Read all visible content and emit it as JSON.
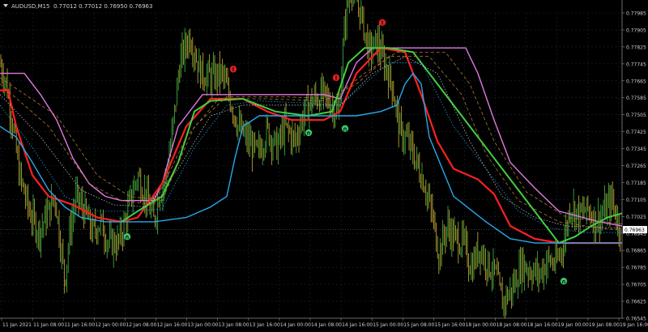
{
  "header": {
    "symbol": "AUDUSD,M15",
    "ohlc": "0.77012 0.77012 0.76950 0.76963"
  },
  "colors": {
    "background": "#000000",
    "grid": "#1c2436",
    "axis": "#8a8a8a",
    "text": "#d0d0d0",
    "candle_up": "#3fa63f",
    "candle_down": "#b7a12e",
    "band_outer": "#e07ae0",
    "band_blue": "#2aa8e8",
    "band_red": "#ff2020",
    "band_green": "#40d040",
    "band_dotted": "#d0d0d0",
    "band_dashed": "#b07a30",
    "signal_up": "#3cc86a",
    "signal_down": "#e02020",
    "price_tag_bg": "#ffffff",
    "price_tag_text": "#000000"
  },
  "chart_data": {
    "type": "candlestick",
    "ylim": [
      0.76545,
      0.77905
    ],
    "price_axis_labels": [
      "0.77985",
      "0.77905",
      "0.77825",
      "0.77745",
      "0.77665",
      "0.77585",
      "0.77505",
      "0.77425",
      "0.77345",
      "0.77265",
      "0.77185",
      "0.77105",
      "0.77025",
      "0.76945",
      "0.76865",
      "0.76785",
      "0.76705",
      "0.76625",
      "0.76545"
    ],
    "current_price": "0.76963",
    "time_axis_labels": [
      "11 Jan 2021",
      "11 Jan 08:00",
      "11 Jan 16:00",
      "12 Jan 00:00",
      "12 Jan 08:00",
      "12 Jan 16:00",
      "13 Jan 00:00",
      "13 Jan 08:00",
      "13 Jan 16:00",
      "14 Jan 00:00",
      "14 Jan 08:00",
      "14 Jan 16:00",
      "15 Jan 00:00",
      "15 Jan 08:00",
      "15 Jan 16:00",
      "18 Jan 00:00",
      "18 Jan 08:00",
      "18 Jan 16:00",
      "19 Jan 00:00",
      "19 Jan 08:00",
      "19 Jan 16:00"
    ],
    "price_path": [
      [
        0,
        0.7775
      ],
      [
        8,
        0.7765
      ],
      [
        16,
        0.7745
      ],
      [
        24,
        0.7722
      ],
      [
        36,
        0.7705
      ],
      [
        48,
        0.7695
      ],
      [
        60,
        0.7705
      ],
      [
        68,
        0.7712
      ],
      [
        74,
        0.7692
      ],
      [
        80,
        0.7672
      ],
      [
        86,
        0.7695
      ],
      [
        94,
        0.7712
      ],
      [
        104,
        0.7705
      ],
      [
        114,
        0.7695
      ],
      [
        124,
        0.77
      ],
      [
        134,
        0.769
      ],
      [
        146,
        0.769
      ],
      [
        156,
        0.7702
      ],
      [
        162,
        0.7712
      ],
      [
        170,
        0.7722
      ],
      [
        180,
        0.7712
      ],
      [
        190,
        0.77
      ],
      [
        196,
        0.7712
      ],
      [
        204,
        0.772
      ],
      [
        212,
        0.774
      ],
      [
        222,
        0.7775
      ],
      [
        234,
        0.7788
      ],
      [
        248,
        0.777
      ],
      [
        262,
        0.7768
      ],
      [
        274,
        0.777
      ],
      [
        284,
        0.7758
      ],
      [
        294,
        0.7745
      ],
      [
        306,
        0.7738
      ],
      [
        318,
        0.7732
      ],
      [
        330,
        0.7743
      ],
      [
        342,
        0.7735
      ],
      [
        352,
        0.7745
      ],
      [
        364,
        0.7738
      ],
      [
        376,
        0.7752
      ],
      [
        388,
        0.7758
      ],
      [
        398,
        0.776
      ],
      [
        410,
        0.7755
      ],
      [
        418,
        0.775
      ],
      [
        426,
        0.7795
      ],
      [
        434,
        0.7812
      ],
      [
        444,
        0.78
      ],
      [
        456,
        0.778
      ],
      [
        466,
        0.7785
      ],
      [
        474,
        0.7775
      ],
      [
        484,
        0.7765
      ],
      [
        494,
        0.7742
      ],
      [
        504,
        0.7738
      ],
      [
        514,
        0.7728
      ],
      [
        524,
        0.7718
      ],
      [
        534,
        0.7702
      ],
      [
        542,
        0.7685
      ],
      [
        552,
        0.7698
      ],
      [
        562,
        0.7692
      ],
      [
        572,
        0.769
      ],
      [
        582,
        0.7678
      ],
      [
        592,
        0.7688
      ],
      [
        602,
        0.768
      ],
      [
        612,
        0.7675
      ],
      [
        620,
        0.7662
      ],
      [
        632,
        0.7668
      ],
      [
        644,
        0.768
      ],
      [
        656,
        0.7677
      ],
      [
        666,
        0.7675
      ],
      [
        676,
        0.7682
      ],
      [
        686,
        0.768
      ],
      [
        696,
        0.769
      ],
      [
        704,
        0.7708
      ],
      [
        716,
        0.7703
      ],
      [
        726,
        0.7706
      ],
      [
        736,
        0.77
      ],
      [
        746,
        0.7705
      ],
      [
        756,
        0.771
      ],
      [
        764,
        0.7698
      ],
      [
        768,
        0.7696
      ]
    ],
    "bands": [
      {
        "name": "outer",
        "pts": [
          [
            0,
            0.777
          ],
          [
            30,
            0.777
          ],
          [
            50,
            0.776
          ],
          [
            70,
            0.7748
          ],
          [
            90,
            0.773
          ],
          [
            110,
            0.7718
          ],
          [
            130,
            0.7712
          ],
          [
            150,
            0.771
          ],
          [
            170,
            0.771
          ],
          [
            190,
            0.771
          ],
          [
            200,
            0.7718
          ],
          [
            220,
            0.7745
          ],
          [
            250,
            0.776
          ],
          [
            300,
            0.776
          ],
          [
            350,
            0.776
          ],
          [
            400,
            0.776
          ],
          [
            420,
            0.7758
          ],
          [
            440,
            0.7775
          ],
          [
            460,
            0.7782
          ],
          [
            500,
            0.7782
          ],
          [
            560,
            0.7782
          ],
          [
            575,
            0.7782
          ],
          [
            590,
            0.777
          ],
          [
            610,
            0.7748
          ],
          [
            630,
            0.7728
          ],
          [
            660,
            0.7716
          ],
          [
            690,
            0.7705
          ],
          [
            710,
            0.7703
          ],
          [
            740,
            0.77
          ],
          [
            768,
            0.7698
          ]
        ]
      },
      {
        "name": "red",
        "pts": [
          [
            0,
            0.7762
          ],
          [
            10,
            0.7762
          ],
          [
            20,
            0.7745
          ],
          [
            40,
            0.7722
          ],
          [
            60,
            0.7712
          ],
          [
            90,
            0.7708
          ],
          [
            120,
            0.7702
          ],
          [
            150,
            0.77
          ],
          [
            170,
            0.7702
          ],
          [
            200,
            0.7718
          ],
          [
            230,
            0.7745
          ],
          [
            260,
            0.7758
          ],
          [
            300,
            0.7758
          ],
          [
            330,
            0.7752
          ],
          [
            360,
            0.7748
          ],
          [
            400,
            0.7748
          ],
          [
            420,
            0.7752
          ],
          [
            440,
            0.777
          ],
          [
            470,
            0.7782
          ],
          [
            500,
            0.778
          ],
          [
            520,
            0.776
          ],
          [
            540,
            0.7738
          ],
          [
            560,
            0.7725
          ],
          [
            590,
            0.772
          ],
          [
            610,
            0.7713
          ],
          [
            630,
            0.7698
          ],
          [
            660,
            0.7692
          ],
          [
            690,
            0.769
          ],
          [
            720,
            0.769
          ],
          [
            768,
            0.769
          ]
        ]
      },
      {
        "name": "green",
        "pts": [
          [
            150,
            0.77
          ],
          [
            170,
            0.7705
          ],
          [
            200,
            0.7712
          ],
          [
            220,
            0.7728
          ],
          [
            240,
            0.7752
          ],
          [
            260,
            0.7757
          ],
          [
            300,
            0.7758
          ],
          [
            340,
            0.7752
          ],
          [
            380,
            0.775
          ],
          [
            410,
            0.7752
          ],
          [
            430,
            0.7775
          ],
          [
            450,
            0.7782
          ],
          [
            480,
            0.7782
          ],
          [
            510,
            0.778
          ],
          [
            690,
            0.769
          ],
          [
            710,
            0.7693
          ],
          [
            730,
            0.7698
          ],
          [
            750,
            0.7702
          ],
          [
            768,
            0.7704
          ]
        ]
      },
      {
        "name": "blue",
        "pts": [
          [
            0,
            0.7745
          ],
          [
            20,
            0.774
          ],
          [
            40,
            0.7728
          ],
          [
            60,
            0.7715
          ],
          [
            80,
            0.7707
          ],
          [
            100,
            0.7702
          ],
          [
            130,
            0.77
          ],
          [
            160,
            0.77
          ],
          [
            190,
            0.77
          ],
          [
            230,
            0.7702
          ],
          [
            260,
            0.7707
          ],
          [
            280,
            0.7712
          ],
          [
            290,
            0.773
          ],
          [
            300,
            0.7745
          ],
          [
            320,
            0.775
          ],
          [
            360,
            0.775
          ],
          [
            400,
            0.775
          ],
          [
            440,
            0.775
          ],
          [
            470,
            0.7752
          ],
          [
            490,
            0.7755
          ],
          [
            500,
            0.7765
          ],
          [
            510,
            0.777
          ],
          [
            520,
            0.7765
          ],
          [
            530,
            0.774
          ],
          [
            560,
            0.7712
          ],
          [
            600,
            0.77
          ],
          [
            630,
            0.7692
          ],
          [
            660,
            0.769
          ],
          [
            690,
            0.769
          ],
          [
            768,
            0.769
          ]
        ]
      },
      {
        "name": "dotted1",
        "pts": [
          [
            0,
            0.7755
          ],
          [
            40,
            0.7735
          ],
          [
            80,
            0.7712
          ],
          [
            120,
            0.7705
          ],
          [
            160,
            0.7705
          ],
          [
            200,
            0.7706
          ],
          [
            240,
            0.7735
          ],
          [
            280,
            0.7755
          ],
          [
            320,
            0.7757
          ],
          [
            380,
            0.7756
          ],
          [
            420,
            0.7755
          ],
          [
            450,
            0.7765
          ],
          [
            480,
            0.7775
          ],
          [
            520,
            0.7775
          ],
          [
            560,
            0.7745
          ],
          [
            600,
            0.7725
          ],
          [
            640,
            0.7705
          ],
          [
            680,
            0.7697
          ],
          [
            720,
            0.7695
          ],
          [
            768,
            0.7695
          ]
        ]
      },
      {
        "name": "dotted2",
        "pts": [
          [
            0,
            0.776
          ],
          [
            50,
            0.774
          ],
          [
            100,
            0.7715
          ],
          [
            140,
            0.7708
          ],
          [
            180,
            0.7707
          ],
          [
            220,
            0.7725
          ],
          [
            260,
            0.775
          ],
          [
            300,
            0.7755
          ],
          [
            360,
            0.7755
          ],
          [
            420,
            0.7755
          ],
          [
            460,
            0.777
          ],
          [
            500,
            0.7778
          ],
          [
            540,
            0.777
          ],
          [
            580,
            0.7738
          ],
          [
            620,
            0.7712
          ],
          [
            660,
            0.7702
          ],
          [
            700,
            0.7698
          ],
          [
            768,
            0.7697
          ]
        ]
      },
      {
        "name": "dashed1",
        "pts": [
          [
            0,
            0.7765
          ],
          [
            60,
            0.7745
          ],
          [
            110,
            0.7718
          ],
          [
            150,
            0.771
          ],
          [
            190,
            0.7708
          ],
          [
            230,
            0.774
          ],
          [
            270,
            0.7758
          ],
          [
            330,
            0.7758
          ],
          [
            400,
            0.7757
          ],
          [
            440,
            0.7765
          ],
          [
            480,
            0.7778
          ],
          [
            530,
            0.7778
          ],
          [
            570,
            0.776
          ],
          [
            600,
            0.7732
          ],
          [
            640,
            0.771
          ],
          [
            690,
            0.77
          ],
          [
            740,
            0.7697
          ],
          [
            768,
            0.7696
          ]
        ]
      },
      {
        "name": "dashed2",
        "pts": [
          [
            0,
            0.7768
          ],
          [
            70,
            0.775
          ],
          [
            120,
            0.7722
          ],
          [
            160,
            0.7712
          ],
          [
            200,
            0.771
          ],
          [
            240,
            0.7745
          ],
          [
            280,
            0.7759
          ],
          [
            350,
            0.7759
          ],
          [
            410,
            0.7758
          ],
          [
            450,
            0.777
          ],
          [
            490,
            0.778
          ],
          [
            550,
            0.778
          ],
          [
            580,
            0.7765
          ],
          [
            610,
            0.7738
          ],
          [
            650,
            0.7714
          ],
          [
            700,
            0.7702
          ],
          [
            768,
            0.7699
          ]
        ]
      }
    ],
    "signals": [
      {
        "dir": "down",
        "x": 288,
        "y": 0.7772
      },
      {
        "dir": "down",
        "x": 415,
        "y": 0.7768
      },
      {
        "dir": "down",
        "x": 472,
        "y": 0.7794
      },
      {
        "dir": "up",
        "x": 157,
        "y": 0.7693
      },
      {
        "dir": "up",
        "x": 381,
        "y": 0.7742
      },
      {
        "dir": "up",
        "x": 426,
        "y": 0.7744
      },
      {
        "dir": "up",
        "x": 696,
        "y": 0.7672
      }
    ]
  }
}
